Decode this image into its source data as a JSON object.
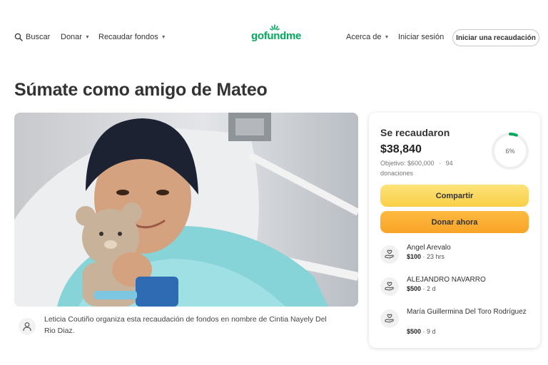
{
  "header": {
    "search_label": "Buscar",
    "donate_label": "Donar",
    "fundraise_label": "Recaudar fondos",
    "logo_text": "gofundme",
    "about_label": "Acerca de",
    "login_label": "Iniciar sesión",
    "cta_label": "Iniciar una recaudación",
    "brand_color": "#02a95c"
  },
  "page": {
    "title": "Súmate como amigo de Mateo"
  },
  "organizer": {
    "text": "Leticia Coutiño organiza esta recaudación de fondos en nombre de Cintia Nayely Del Rio Diaz."
  },
  "campaign": {
    "raised_label": "Se recaudaron",
    "raised_amount": "$38,840",
    "goal_text": "Objetivo: $600,000",
    "donations_count": "94",
    "donations_label": "donaciones",
    "progress_percent": 6,
    "progress_label": "6%",
    "share_label": "Compartir",
    "donate_now_label": "Donar ahora"
  },
  "donations": [
    {
      "name": "Angel Arevalo",
      "amount": "$100",
      "time": "23 hrs"
    },
    {
      "name": "ALEJANDRO NAVARRO",
      "amount": "$500",
      "time": "2 d"
    },
    {
      "name": "María Guillermina Del Toro Rodríguez",
      "amount": "$500",
      "time": "9 d"
    }
  ]
}
